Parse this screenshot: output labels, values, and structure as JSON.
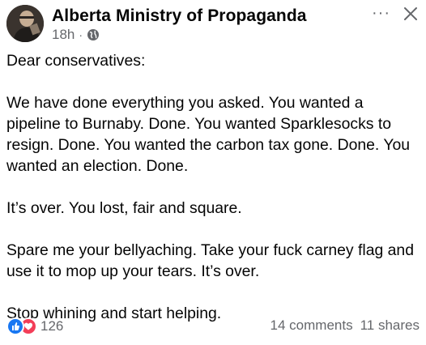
{
  "post": {
    "author": "Alberta Ministry of Propaganda",
    "time": "18h",
    "separator": "·",
    "privacy_icon": "globe-icon",
    "more_icon": "more-horizontal-icon",
    "close_icon": "close-icon",
    "paragraphs": [
      "Dear conservatives:",
      "We have done everything you asked. You wanted a pipeline to Burnaby. Done. You wanted Sparklesocks to resign. Done. You wanted the carbon tax gone. Done. You wanted an election. Done.",
      "It’s over. You lost, fair and square.",
      "Spare me your bellyaching. Take your fuck carney flag and use it to mop up your tears. It’s over.",
      "Stop whining and start helping."
    ],
    "reaction_count": "126",
    "comments": "14 comments",
    "shares": "11 shares"
  },
  "colors": {
    "text": "#050505",
    "secondary": "#65676b",
    "like": "#1877f2",
    "love": "#f33e58"
  }
}
